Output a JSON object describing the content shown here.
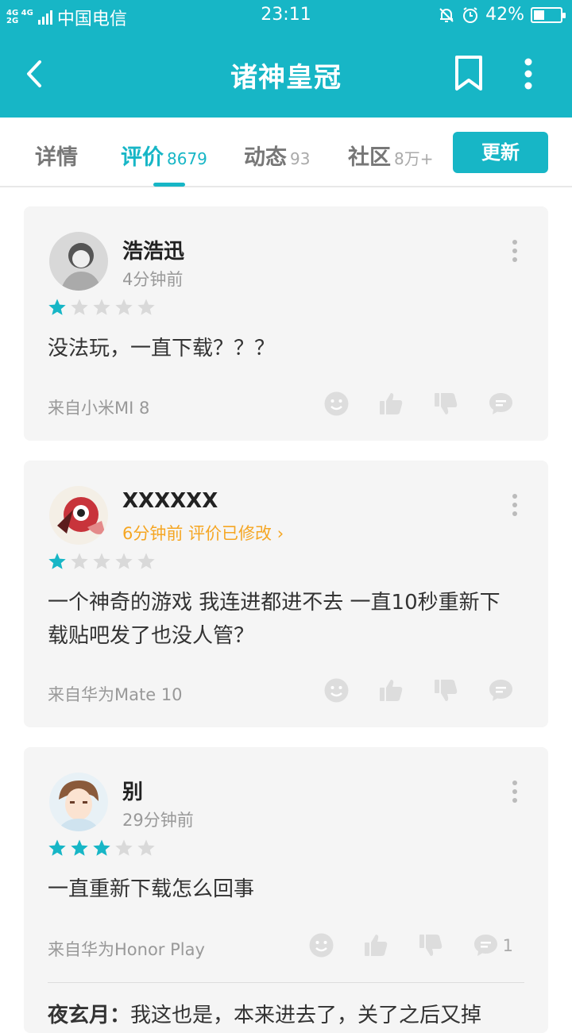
{
  "status": {
    "network_top": "4G 4G",
    "network_bottom": "2G",
    "carrier": "中国电信",
    "time": "23:11",
    "battery": "42%",
    "battery_level": 0.42
  },
  "header": {
    "title": "诸神皇冠",
    "back_icon": "back-arrow-icon",
    "bookmark_icon": "bookmark-icon",
    "more_icon": "more-vertical-icon"
  },
  "tabs": [
    {
      "label": "详情",
      "count": ""
    },
    {
      "label": "评价",
      "count": "8679"
    },
    {
      "label": "动态",
      "count": "93"
    },
    {
      "label": "社区",
      "count": "8万+"
    }
  ],
  "update_button": "更新",
  "colors": {
    "accent": "#17b6c6",
    "edited": "#f5a623",
    "star_off": "#d9d9d9"
  },
  "reviews": [
    {
      "username": "浩浩迅",
      "time": "4分钟前",
      "rating": 1,
      "content": "没法玩，一直下载？？？",
      "device": "来自小米MI 8",
      "comment_count": ""
    },
    {
      "username": "XXXXXX",
      "time": "6分钟前 评价已修改",
      "rating": 1,
      "content": "一个神奇的游戏 我连进都进不去 一直10秒重新下载贴吧发了也没人管？",
      "device": "来自华为Mate 10",
      "comment_count": ""
    },
    {
      "username": "别",
      "time": "29分钟前",
      "rating": 3,
      "content": "一直重新下载怎么回事",
      "device": "来自华为Honor Play",
      "comment_count": "1",
      "reply_user": "夜玄月：",
      "reply_text": "我这也是，本来进去了，关了之后又掉"
    }
  ]
}
